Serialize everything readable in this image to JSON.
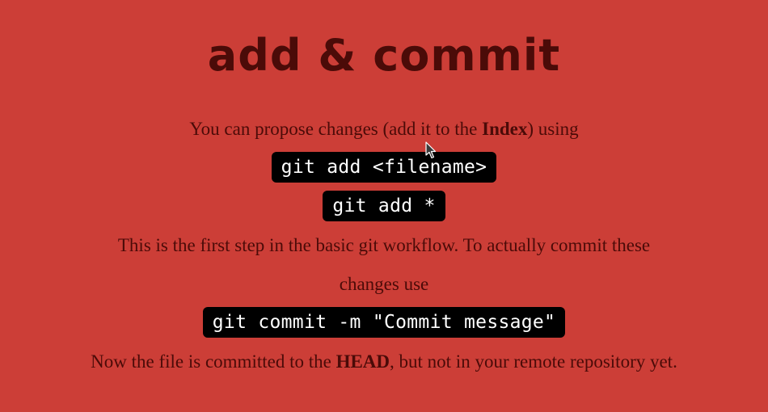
{
  "title": "add & commit",
  "para1": {
    "before": "You can propose changes (add it to the ",
    "bold": "Index",
    "after": ") using"
  },
  "code1": "git add <filename>",
  "code2": "git add *",
  "para2_line1": "This is the first step in the basic git workflow. To actually commit these",
  "para2_line2": "changes use",
  "code3": "git commit -m \"Commit message\"",
  "para3": {
    "before": "Now the file is committed to the ",
    "bold": "HEAD",
    "after": ", but not in your remote repository yet."
  },
  "colors": {
    "background": "#cc3e37",
    "text": "#4b0b08",
    "code_background": "#000000",
    "code_text": "#ffffff"
  },
  "icons": {
    "cursor": "mouse-pointer-icon"
  }
}
